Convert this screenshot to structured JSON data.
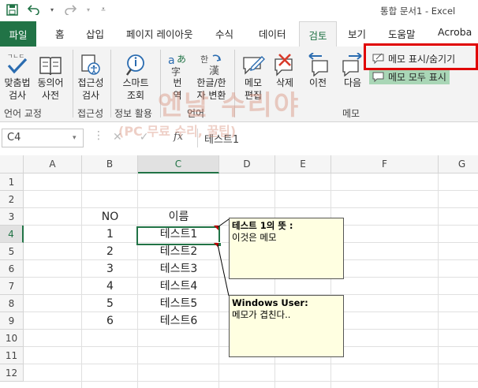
{
  "title_bar": {
    "title": "통합 문서1 - Excel"
  },
  "tabs": [
    "파일",
    "홈",
    "삽입",
    "페이지 레이아웃",
    "수식",
    "데이터",
    "검토",
    "보기",
    "도움말",
    "Acroba"
  ],
  "active_tab": "검토",
  "ribbon": {
    "buttons": {
      "spelling": [
        "맞춤법",
        "검사"
      ],
      "thesaurus": [
        "동의어",
        "사전"
      ],
      "accessibility": [
        "접근성",
        "검사"
      ],
      "smart_lookup": [
        "스마트",
        "조회"
      ],
      "translate": [
        "번",
        "역"
      ],
      "hanja": [
        "한글/한",
        "자 변환"
      ],
      "edit_comment": [
        "메모",
        "편집"
      ],
      "delete_comment": "삭제",
      "prev_comment": "이전",
      "next_comment": "다음",
      "show_hide_comment": "메모 표시/숨기기",
      "show_all_comments": "메모 모두 표시"
    },
    "groups": {
      "proofing": "언어 교정",
      "accessibility": "접근성",
      "insights": "정보 활용",
      "language": "언어",
      "comments": "메모"
    }
  },
  "formula_bar": {
    "name_box": "C4",
    "fx": "fx",
    "value": "테스트1"
  },
  "watermark": {
    "line1": "엔날 수리야",
    "line2": "(PC 무료 수리, 꿀팁)"
  },
  "sheet": {
    "columns": [
      "A",
      "B",
      "C",
      "D",
      "E",
      "F",
      "G"
    ],
    "rows": [
      "1",
      "2",
      "3",
      "4",
      "5",
      "6",
      "7",
      "8",
      "9",
      "10",
      "11",
      "12"
    ],
    "cells": {
      "B3": "NO",
      "C3": "이름",
      "B4": "1",
      "C4": "테스트1",
      "B5": "2",
      "C5": "테스트2",
      "B6": "3",
      "C6": "테스트3",
      "B7": "4",
      "C7": "테스트4",
      "B8": "5",
      "C8": "테스트5",
      "B9": "6",
      "C9": "테스트6"
    }
  },
  "comments": [
    {
      "author": "테스트 1의 뜻 :",
      "text": "이것은 메모"
    },
    {
      "author": "Windows User:",
      "text": "메모가 겹친다.."
    }
  ],
  "colors": {
    "excel_green": "#217346",
    "highlight_red": "#e00000",
    "comment_bg": "#ffffe1"
  }
}
